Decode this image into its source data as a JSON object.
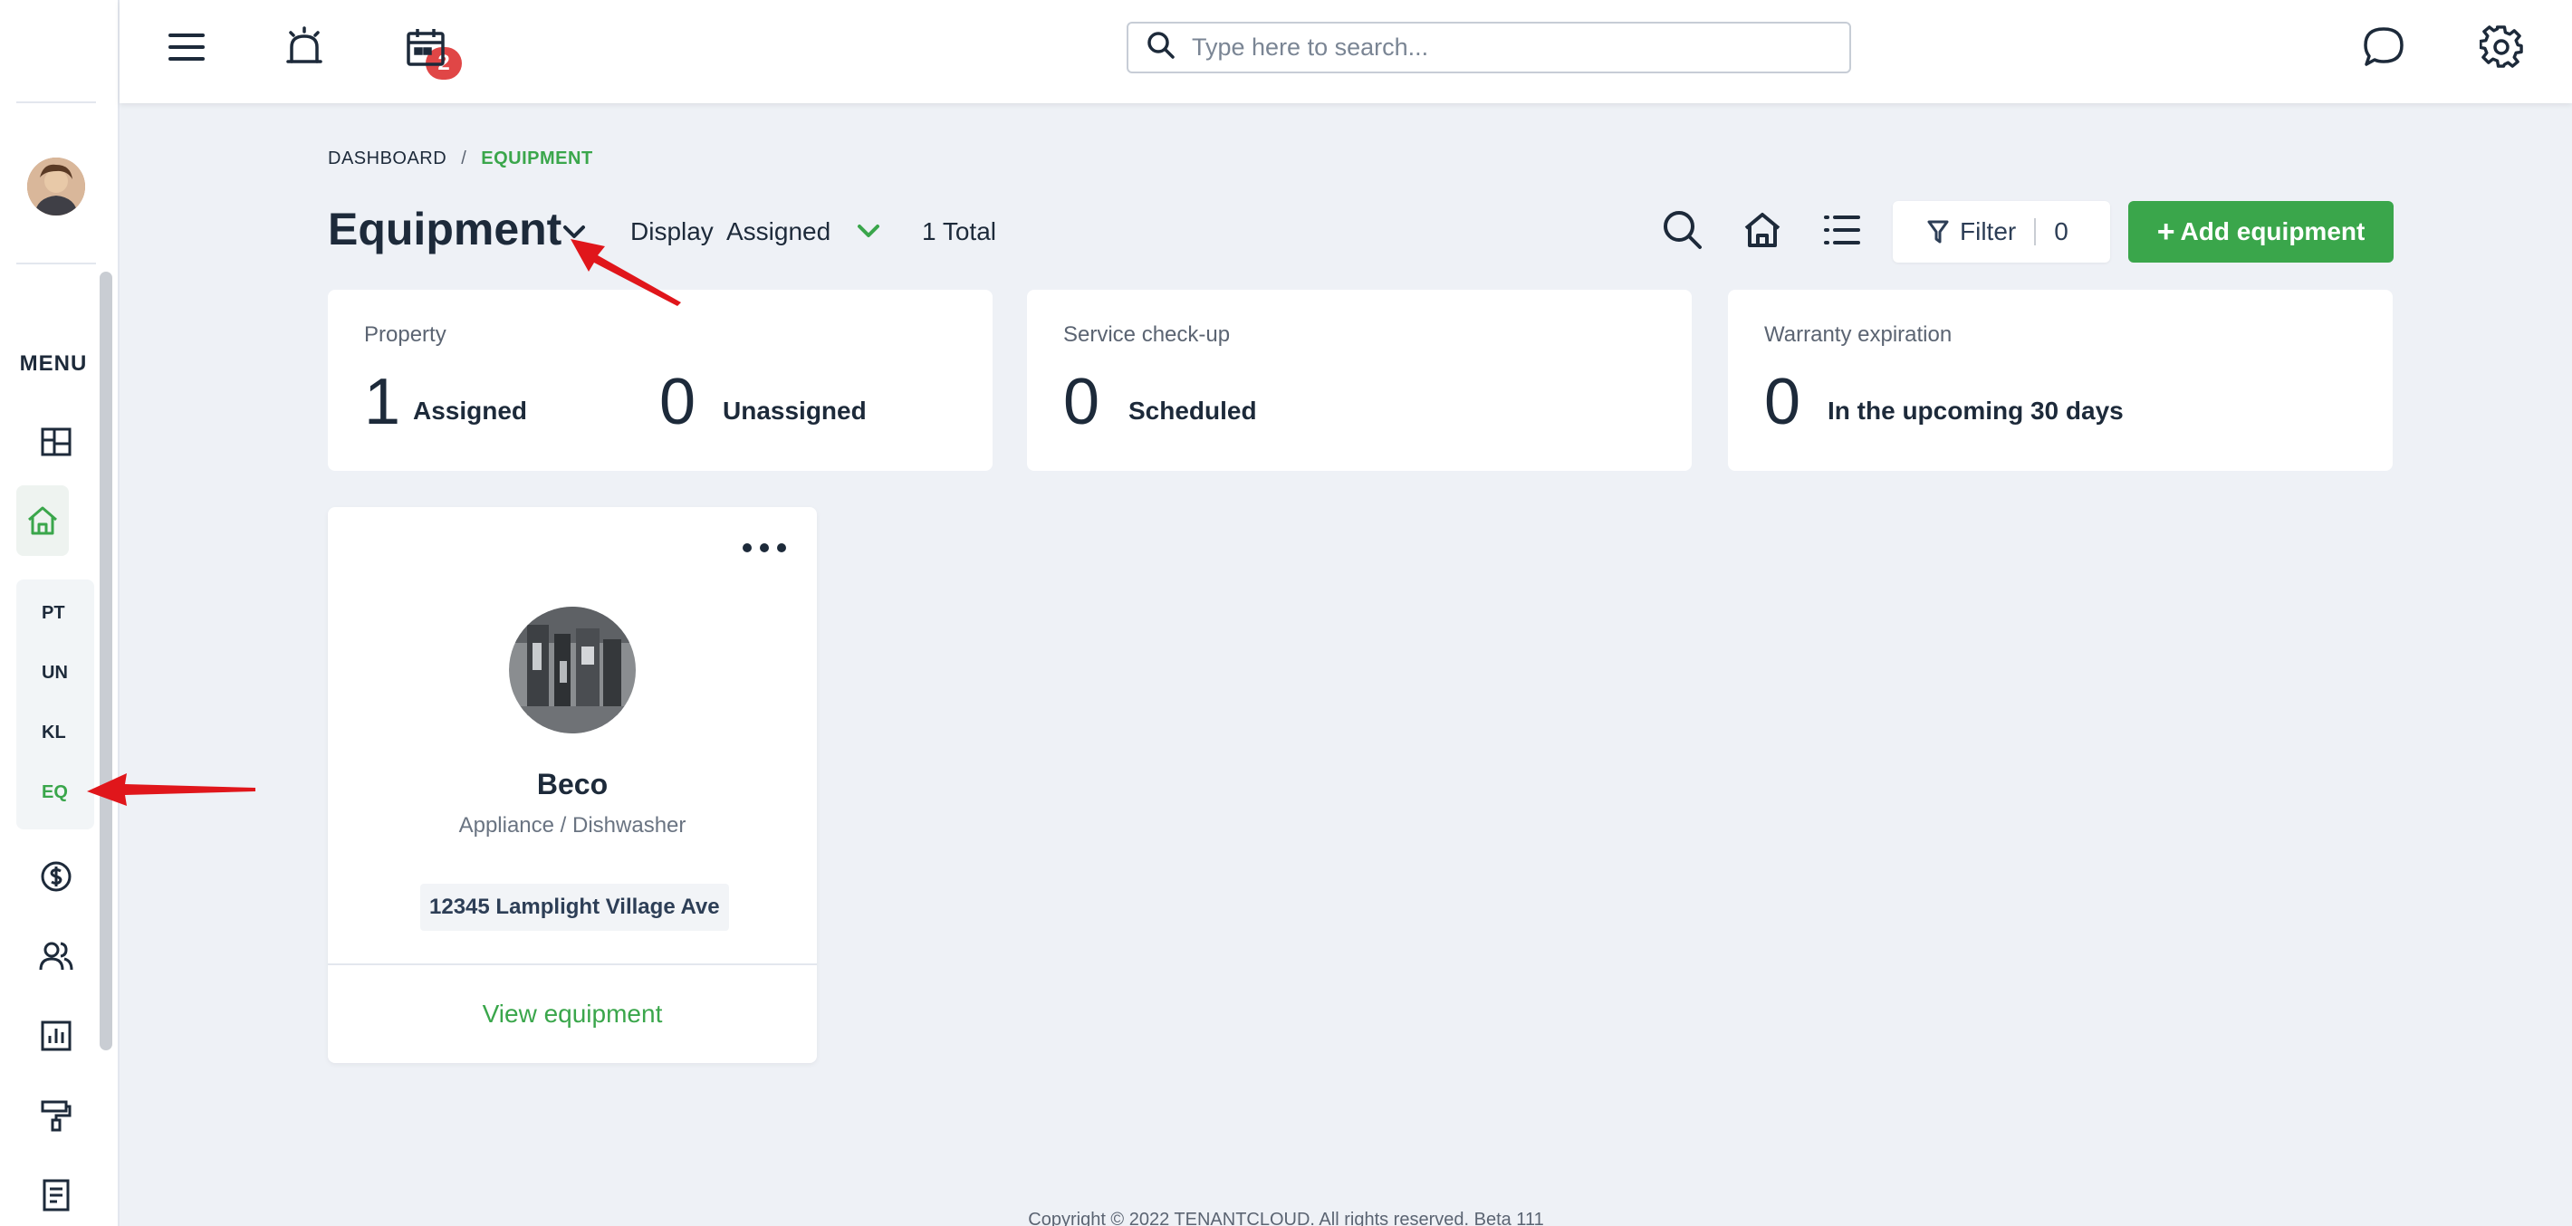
{
  "header": {
    "search_placeholder": "Type here to search...",
    "notification_count": "2"
  },
  "sidebar": {
    "menu_title": "MENU",
    "sub_items": [
      {
        "label": "PT"
      },
      {
        "label": "UN"
      },
      {
        "label": "KL"
      },
      {
        "label": "EQ"
      }
    ]
  },
  "breadcrumb": {
    "root": "DASHBOARD",
    "separator": "/",
    "current": "EQUIPMENT"
  },
  "page": {
    "title": "Equipment",
    "display_label": "Display",
    "display_value": "Assigned",
    "total": "1 Total",
    "filter_label": "Filter",
    "filter_count": "0",
    "add_label": "Add equipment"
  },
  "stats": {
    "property": {
      "label": "Property",
      "assigned_num": "1",
      "assigned_text": "Assigned",
      "unassigned_num": "0",
      "unassigned_text": "Unassigned"
    },
    "service": {
      "label": "Service check-up",
      "num": "0",
      "text": "Scheduled"
    },
    "warranty": {
      "label": "Warranty expiration",
      "num": "0",
      "text": "In the upcoming 30 days"
    }
  },
  "equipment_card": {
    "name": "Beco",
    "category": "Appliance / Dishwasher",
    "address": "12345 Lamplight Village Ave",
    "view_label": "View equipment"
  },
  "footer": {
    "text": "Copyright © 2022 TENANTCLOUD. All rights reserved. Beta 111"
  },
  "colors": {
    "accent": "#3aa64b",
    "badge": "#e04646",
    "background": "#eef1f6",
    "annotation_arrow": "#e0161b"
  }
}
